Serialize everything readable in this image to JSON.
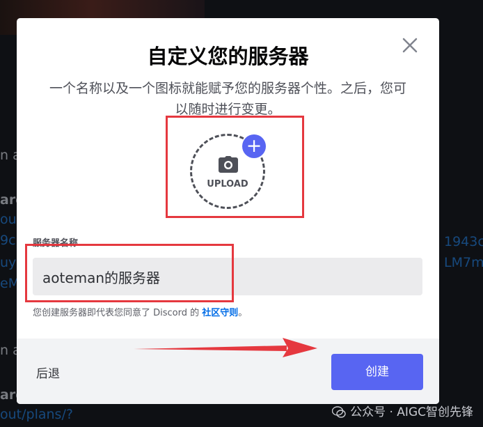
{
  "background": {
    "fragments": [
      "n a",
      "are",
      "out/",
      "9c",
      "uy",
      "eM",
      "n a",
      "are",
      "out/plans/?"
    ],
    "right_fragments": [
      "1943c",
      "LM7m"
    ]
  },
  "modal": {
    "title": "自定义您的服务器",
    "description": "一个名称以及一个图标就能赋予您的服务器个性。之后，您可以随时进行变更。",
    "upload_label": "UPLOAD",
    "plus_glyph": "+",
    "server_name_label": "服务器名称",
    "server_name_value": "aoteman的服务器",
    "terms_text": "您创建服务器即代表您同意了 Discord 的 ",
    "terms_link": "社区守则",
    "terms_end": "。",
    "back_label": "后退",
    "create_label": "创建"
  },
  "watermark": "公众号 · AIGC智创先锋",
  "colors": {
    "accent": "#5865f2",
    "annotation": "#e5383f",
    "link": "#006ce7"
  }
}
